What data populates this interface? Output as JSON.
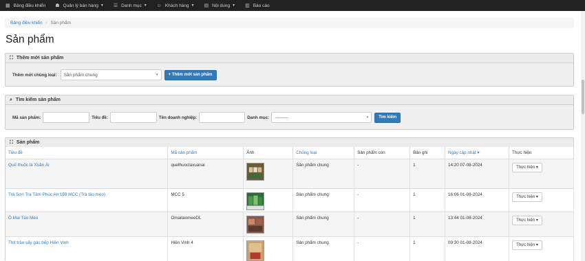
{
  "nav": {
    "items": [
      {
        "label": "Bảng điều khiển",
        "icon": "dashboard-icon",
        "glyph": "▦",
        "caret": false
      },
      {
        "label": "Quản lý bán hàng",
        "icon": "cart-icon",
        "glyph": "☗",
        "caret": true
      },
      {
        "label": "Danh mục",
        "icon": "list-icon",
        "glyph": "☰",
        "caret": true
      },
      {
        "label": "Khách hàng",
        "icon": "users-icon",
        "glyph": "☺",
        "caret": true
      },
      {
        "label": "Nội dung",
        "icon": "content-icon",
        "glyph": "▤",
        "caret": true
      },
      {
        "label": "Báo cáo",
        "icon": "report-icon",
        "glyph": "▥",
        "caret": false
      }
    ]
  },
  "breadcrumb": {
    "home": "Bảng điều khiển",
    "separator": "/",
    "current": "Sản phẩm"
  },
  "page_title": "Sản phẩm",
  "add_panel": {
    "title": "Thêm mới sản phẩm",
    "type_label": "Thêm mới chủng loại:",
    "type_value": "Sản phẩm chung",
    "add_button": "+ Thêm mới sản phẩm"
  },
  "search_panel": {
    "title": "Tìm kiếm sản phẩm",
    "code_label": "Mã sản phẩm:",
    "title_label": "Tiêu đề:",
    "company_label": "Tên doanh nghiệp:",
    "category_label": "Danh mục:",
    "category_value": "---------",
    "search_button": "Tìm kiếm"
  },
  "list_panel": {
    "title": "Sản phẩm"
  },
  "table": {
    "headers": [
      "Tiêu đề",
      "Mã sản phẩm",
      "Ảnh",
      "Chủng loại",
      "Sản phẩm con",
      "Bản ghi",
      "Ngày cập nhật ▾",
      "Thực hiện"
    ],
    "rows": [
      {
        "title": "Quế thuốc lá Xuân Ái",
        "code": "quethuoclaxuanai",
        "type": "Sản phẩm chung",
        "children": "-",
        "records": "1",
        "updated": "14:20 07-08-2024",
        "action": "Thực hiện ▾"
      },
      {
        "title": "Trà Sơn Tra Tâm Phúc An 159 MCC (Trà táo mèo)",
        "code": "MCC 5",
        "type": "Sản phẩm chung",
        "children": "-",
        "records": "1",
        "updated": "16:06 01-08-2024",
        "action": "Thực hiện ▾"
      },
      {
        "title": "Ô Mai Táo Mèo",
        "code": "OmaitaomeoDL",
        "type": "Sản phẩm chung",
        "children": "-",
        "records": "1",
        "updated": "13:44 01-08-2024",
        "action": "Thực hiện ▾"
      },
      {
        "title": "Thịt trâu sấy gác bếp Hiền Vinh",
        "code": "Hiền Vinh 4",
        "type": "Sản phẩm chung",
        "children": "-",
        "records": "1",
        "updated": "09:30 01-08-2024",
        "action": "Thực hiện ▾"
      }
    ]
  },
  "colors": {
    "nav_bg": "#222222",
    "link": "#337ab7",
    "primary_button": "#337ab7"
  }
}
